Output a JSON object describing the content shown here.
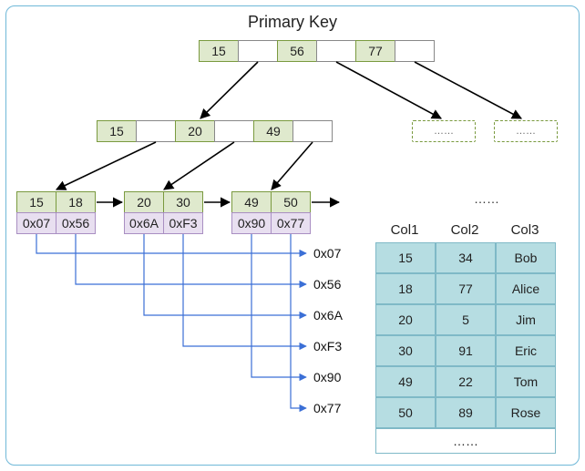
{
  "title": "Primary Key",
  "root": {
    "keys": [
      "15",
      "56",
      "77"
    ]
  },
  "mid": {
    "keys": [
      "15",
      "20",
      "49"
    ]
  },
  "leaves": [
    {
      "keys": [
        "15",
        "18"
      ],
      "ptrs": [
        "0x07",
        "0x56"
      ]
    },
    {
      "keys": [
        "20",
        "30"
      ],
      "ptrs": [
        "0x6A",
        "0xF3"
      ]
    },
    {
      "keys": [
        "49",
        "50"
      ],
      "ptrs": [
        "0x90",
        "0x77"
      ]
    }
  ],
  "followPointers": [
    "0x07",
    "0x56",
    "0x6A",
    "0xF3",
    "0x90",
    "0x77"
  ],
  "dashPlaceholders": [
    "……",
    "……"
  ],
  "ellipsis": "……",
  "table": {
    "headers": [
      "Col1",
      "Col2",
      "Col3"
    ],
    "rows": [
      [
        "15",
        "34",
        "Bob"
      ],
      [
        "18",
        "77",
        "Alice"
      ],
      [
        "20",
        "5",
        "Jim"
      ],
      [
        "30",
        "91",
        "Eric"
      ],
      [
        "49",
        "22",
        "Tom"
      ],
      [
        "50",
        "89",
        "Rose"
      ]
    ],
    "footer": "……"
  }
}
